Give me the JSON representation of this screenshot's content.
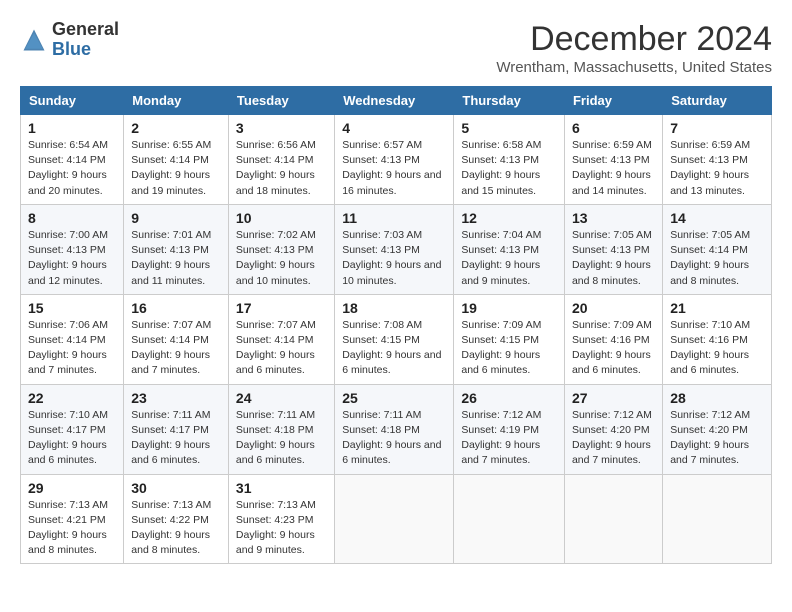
{
  "header": {
    "logo": {
      "line1": "General",
      "line2": "Blue"
    },
    "title": "December 2024",
    "location": "Wrentham, Massachusetts, United States"
  },
  "calendar": {
    "days_of_week": [
      "Sunday",
      "Monday",
      "Tuesday",
      "Wednesday",
      "Thursday",
      "Friday",
      "Saturday"
    ],
    "weeks": [
      [
        null,
        null,
        null,
        null,
        null,
        null,
        null
      ]
    ],
    "cells": [
      {
        "day": 1,
        "col": 0,
        "sunrise": "6:54 AM",
        "sunset": "4:14 PM",
        "daylight": "9 hours and 20 minutes."
      },
      {
        "day": 2,
        "col": 1,
        "sunrise": "6:55 AM",
        "sunset": "4:14 PM",
        "daylight": "9 hours and 19 minutes."
      },
      {
        "day": 3,
        "col": 2,
        "sunrise": "6:56 AM",
        "sunset": "4:14 PM",
        "daylight": "9 hours and 18 minutes."
      },
      {
        "day": 4,
        "col": 3,
        "sunrise": "6:57 AM",
        "sunset": "4:13 PM",
        "daylight": "9 hours and 16 minutes."
      },
      {
        "day": 5,
        "col": 4,
        "sunrise": "6:58 AM",
        "sunset": "4:13 PM",
        "daylight": "9 hours and 15 minutes."
      },
      {
        "day": 6,
        "col": 5,
        "sunrise": "6:59 AM",
        "sunset": "4:13 PM",
        "daylight": "9 hours and 14 minutes."
      },
      {
        "day": 7,
        "col": 6,
        "sunrise": "6:59 AM",
        "sunset": "4:13 PM",
        "daylight": "9 hours and 13 minutes."
      },
      {
        "day": 8,
        "col": 0,
        "sunrise": "7:00 AM",
        "sunset": "4:13 PM",
        "daylight": "9 hours and 12 minutes."
      },
      {
        "day": 9,
        "col": 1,
        "sunrise": "7:01 AM",
        "sunset": "4:13 PM",
        "daylight": "9 hours and 11 minutes."
      },
      {
        "day": 10,
        "col": 2,
        "sunrise": "7:02 AM",
        "sunset": "4:13 PM",
        "daylight": "9 hours and 10 minutes."
      },
      {
        "day": 11,
        "col": 3,
        "sunrise": "7:03 AM",
        "sunset": "4:13 PM",
        "daylight": "9 hours and 10 minutes."
      },
      {
        "day": 12,
        "col": 4,
        "sunrise": "7:04 AM",
        "sunset": "4:13 PM",
        "daylight": "9 hours and 9 minutes."
      },
      {
        "day": 13,
        "col": 5,
        "sunrise": "7:05 AM",
        "sunset": "4:13 PM",
        "daylight": "9 hours and 8 minutes."
      },
      {
        "day": 14,
        "col": 6,
        "sunrise": "7:05 AM",
        "sunset": "4:14 PM",
        "daylight": "9 hours and 8 minutes."
      },
      {
        "day": 15,
        "col": 0,
        "sunrise": "7:06 AM",
        "sunset": "4:14 PM",
        "daylight": "9 hours and 7 minutes."
      },
      {
        "day": 16,
        "col": 1,
        "sunrise": "7:07 AM",
        "sunset": "4:14 PM",
        "daylight": "9 hours and 7 minutes."
      },
      {
        "day": 17,
        "col": 2,
        "sunrise": "7:07 AM",
        "sunset": "4:14 PM",
        "daylight": "9 hours and 6 minutes."
      },
      {
        "day": 18,
        "col": 3,
        "sunrise": "7:08 AM",
        "sunset": "4:15 PM",
        "daylight": "9 hours and 6 minutes."
      },
      {
        "day": 19,
        "col": 4,
        "sunrise": "7:09 AM",
        "sunset": "4:15 PM",
        "daylight": "9 hours and 6 minutes."
      },
      {
        "day": 20,
        "col": 5,
        "sunrise": "7:09 AM",
        "sunset": "4:16 PM",
        "daylight": "9 hours and 6 minutes."
      },
      {
        "day": 21,
        "col": 6,
        "sunrise": "7:10 AM",
        "sunset": "4:16 PM",
        "daylight": "9 hours and 6 minutes."
      },
      {
        "day": 22,
        "col": 0,
        "sunrise": "7:10 AM",
        "sunset": "4:17 PM",
        "daylight": "9 hours and 6 minutes."
      },
      {
        "day": 23,
        "col": 1,
        "sunrise": "7:11 AM",
        "sunset": "4:17 PM",
        "daylight": "9 hours and 6 minutes."
      },
      {
        "day": 24,
        "col": 2,
        "sunrise": "7:11 AM",
        "sunset": "4:18 PM",
        "daylight": "9 hours and 6 minutes."
      },
      {
        "day": 25,
        "col": 3,
        "sunrise": "7:11 AM",
        "sunset": "4:18 PM",
        "daylight": "9 hours and 6 minutes."
      },
      {
        "day": 26,
        "col": 4,
        "sunrise": "7:12 AM",
        "sunset": "4:19 PM",
        "daylight": "9 hours and 7 minutes."
      },
      {
        "day": 27,
        "col": 5,
        "sunrise": "7:12 AM",
        "sunset": "4:20 PM",
        "daylight": "9 hours and 7 minutes."
      },
      {
        "day": 28,
        "col": 6,
        "sunrise": "7:12 AM",
        "sunset": "4:20 PM",
        "daylight": "9 hours and 7 minutes."
      },
      {
        "day": 29,
        "col": 0,
        "sunrise": "7:13 AM",
        "sunset": "4:21 PM",
        "daylight": "9 hours and 8 minutes."
      },
      {
        "day": 30,
        "col": 1,
        "sunrise": "7:13 AM",
        "sunset": "4:22 PM",
        "daylight": "9 hours and 8 minutes."
      },
      {
        "day": 31,
        "col": 2,
        "sunrise": "7:13 AM",
        "sunset": "4:23 PM",
        "daylight": "9 hours and 9 minutes."
      }
    ]
  }
}
